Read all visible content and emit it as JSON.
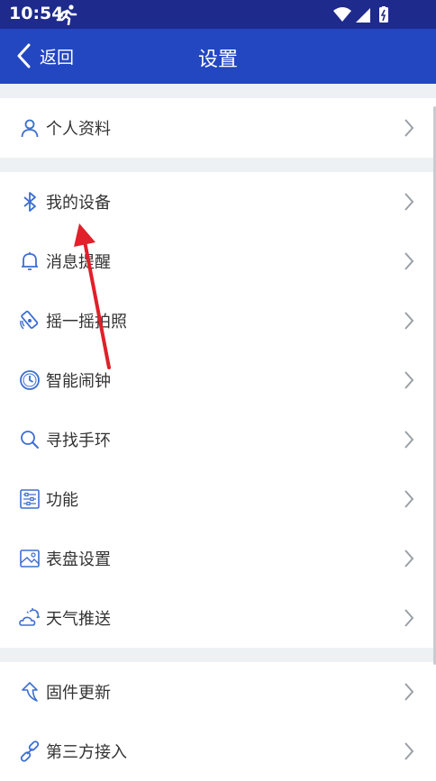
{
  "status_bar": {
    "time": "10:54"
  },
  "header": {
    "back_label": "返回",
    "title": "设置"
  },
  "sections": [
    {
      "items": [
        {
          "label": "个人资料",
          "icon": "person-icon"
        }
      ]
    },
    {
      "items": [
        {
          "label": "我的设备",
          "icon": "bluetooth-icon"
        },
        {
          "label": "消息提醒",
          "icon": "bell-icon"
        },
        {
          "label": "摇一摇拍照",
          "icon": "shake-phone-icon"
        },
        {
          "label": "智能闹钟",
          "icon": "clock-icon"
        },
        {
          "label": "寻找手环",
          "icon": "search-icon"
        },
        {
          "label": "功能",
          "icon": "sliders-icon"
        },
        {
          "label": "表盘设置",
          "icon": "watchface-icon"
        },
        {
          "label": "天气推送",
          "icon": "weather-icon"
        }
      ]
    },
    {
      "items": [
        {
          "label": "固件更新",
          "icon": "update-arrow-icon"
        },
        {
          "label": "第三方接入",
          "icon": "link-icon"
        }
      ]
    }
  ],
  "colors": {
    "status_bar": "#1e2a8c",
    "nav_bar": "#2346c1",
    "icon": "#3d6ed1",
    "annotation_arrow": "#e0202a"
  }
}
